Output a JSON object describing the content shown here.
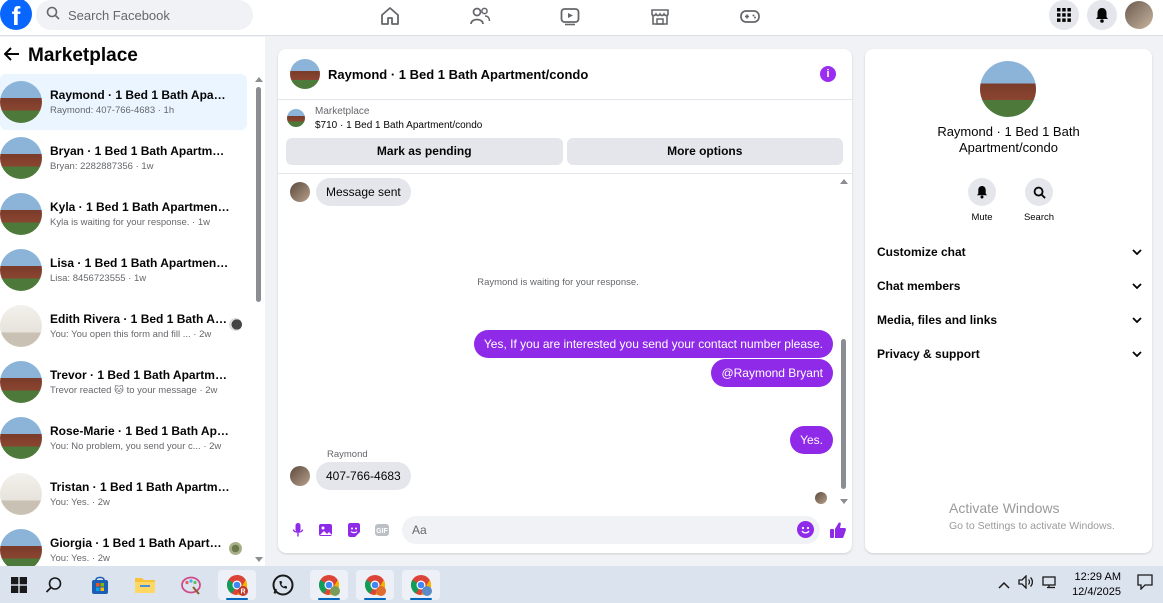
{
  "topbar": {
    "logo": "f",
    "search_placeholder": "Search Facebook"
  },
  "sidebar": {
    "title": "Marketplace",
    "conversations": [
      {
        "name": "Raymond · 1 Bed 1 Bath Apartm...",
        "sub": "Raymond: 407-766-4683 · 1h",
        "thumb": "house",
        "active": true
      },
      {
        "name": "Bryan · 1 Bed 1 Bath Apartment/...",
        "sub": "Bryan: 2282887356 · 1w",
        "thumb": "house"
      },
      {
        "name": "Kyla · 1 Bed 1 Bath Apartment/c...",
        "sub": "Kyla is waiting for your response. · 1w",
        "thumb": "house"
      },
      {
        "name": "Lisa · 1 Bed 1 Bath Apartment/co...",
        "sub": "Lisa: 8456723555 · 1w",
        "thumb": "house"
      },
      {
        "name": "Edith Rivera · 1 Bed 1 Bath Ap...",
        "sub": "You: You open this form and fill ... · 2w",
        "thumb": "room"
      },
      {
        "name": "Trevor · 1 Bed 1 Bath Apartment/...",
        "sub": "Trevor reacted 🐱 to your message · 2w",
        "thumb": "house"
      },
      {
        "name": "Rose-Marie · 1 Bed 1 Bath Apart...",
        "sub": "You: No problem, you send your c... · 2w",
        "thumb": "house"
      },
      {
        "name": "Tristan · 1 Bed 1 Bath Apartment...",
        "sub": "You: Yes. · 2w",
        "thumb": "room"
      },
      {
        "name": "Giorgia · 1 Bed 1 Bath Apartm...",
        "sub": "You: Yes. · 2w",
        "thumb": "house"
      }
    ]
  },
  "chat": {
    "title": "Raymond · 1 Bed 1 Bath Apartment/condo",
    "info_icon": "i",
    "listing_source": "Marketplace",
    "listing_price": "$710 · 1 Bed 1 Bath Apartment/condo",
    "mark_pending": "Mark as pending",
    "more_options": "More options",
    "messages": {
      "m1": "Message sent",
      "system": "Raymond is waiting for your response.",
      "out1": "Yes, If you are interested you send your contact number please.",
      "out2": "@Raymond Bryant",
      "out3": "Yes.",
      "sender": "Raymond",
      "in2": "407-766-4683"
    },
    "composer_placeholder": "Aa"
  },
  "info": {
    "name": "Raymond · 1 Bed 1 Bath Apartment/condo",
    "mute": "Mute",
    "search": "Search",
    "sections": [
      "Customize chat",
      "Chat members",
      "Media, files and links",
      "Privacy & support"
    ],
    "activate_title": "Activate Windows",
    "activate_sub": "Go to Settings to activate Windows."
  },
  "taskbar": {
    "time": "12:29 AM",
    "date": "12/4/2025",
    "icons": [
      "windows-start",
      "search",
      "store",
      "file-explorer",
      "paint",
      "chrome-r",
      "whatsapp",
      "chrome-2",
      "chrome-3",
      "chrome-4"
    ]
  },
  "colors": {
    "brand_blue": "#0866ff",
    "messenger_purple": "#8f2be8",
    "active_row": "#ebf5ff"
  }
}
